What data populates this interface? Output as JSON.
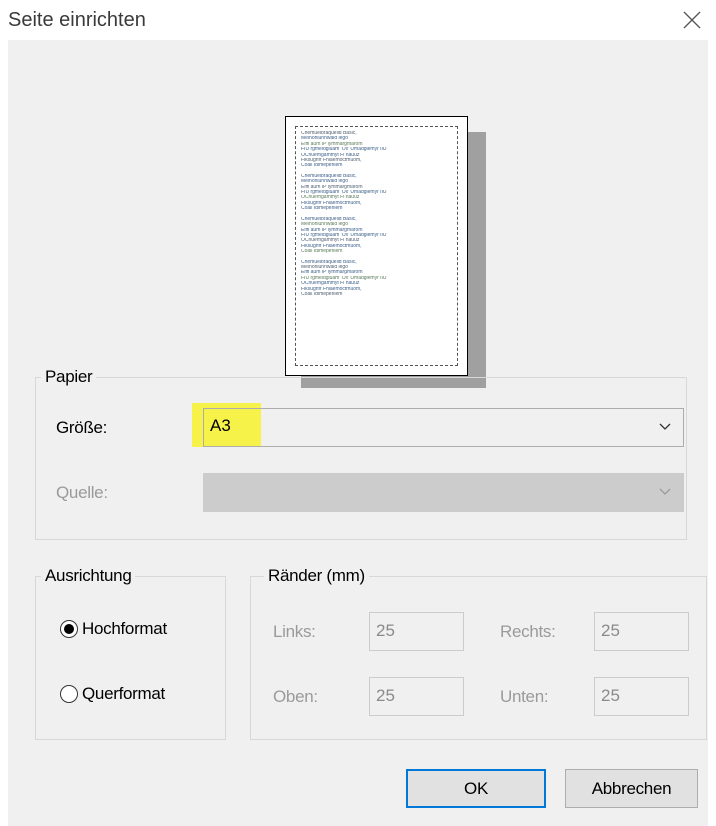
{
  "window": {
    "title": "Seite einrichten",
    "close_icon": "close-icon"
  },
  "preview": {
    "text_lines": [
      "Chemuelbraquelid Basic,",
      "Meinonlunnwald lego",
      "Eiffi aum IP lymmargmarom",
      "FIU rgmeldgluam 'Ox' Umadglemyr IIU",
      "OCnuemgammyt Fl nauuz",
      "Fiksugnfr Fhlaemoctmuom,",
      "Coall Idimeperliem"
    ],
    "blocks": 4
  },
  "paper": {
    "legend": "Papier",
    "size_label": "Größe:",
    "size_value": "A3",
    "source_label": "Quelle:",
    "source_value": ""
  },
  "orientation": {
    "legend": "Ausrichtung",
    "options": [
      {
        "label": "Hochformat",
        "selected": true
      },
      {
        "label": "Querformat",
        "selected": false
      }
    ]
  },
  "margins": {
    "legend": "Ränder (mm)",
    "left_label": "Links:",
    "left_value": "25",
    "right_label": "Rechts:",
    "right_value": "25",
    "top_label": "Oben:",
    "top_value": "25",
    "bottom_label": "Unten:",
    "bottom_value": "25"
  },
  "buttons": {
    "ok": "OK",
    "cancel": "Abbrechen"
  },
  "colors": {
    "highlight": "#f6f24a",
    "default_button_border": "#0078d7",
    "dialog_background": "#f0f0f0"
  }
}
